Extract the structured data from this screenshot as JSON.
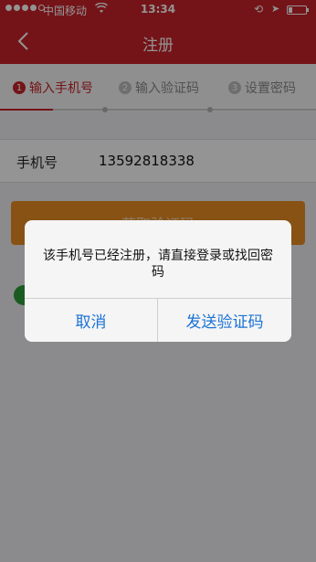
{
  "statusbar": {
    "carrier": "中国移动",
    "time": "13:34"
  },
  "navbar": {
    "title": "注册"
  },
  "steps": [
    {
      "num": "1",
      "label": "输入手机号"
    },
    {
      "num": "2",
      "label": "输入验证码"
    },
    {
      "num": "3",
      "label": "设置密码"
    }
  ],
  "form": {
    "phone_label": "手机号",
    "phone_value": "13592818338",
    "get_code_label": "获取验证码"
  },
  "alert": {
    "message": "该手机号已经注册，请直接登录或找回密码",
    "cancel": "取消",
    "send": "发送验证码"
  }
}
